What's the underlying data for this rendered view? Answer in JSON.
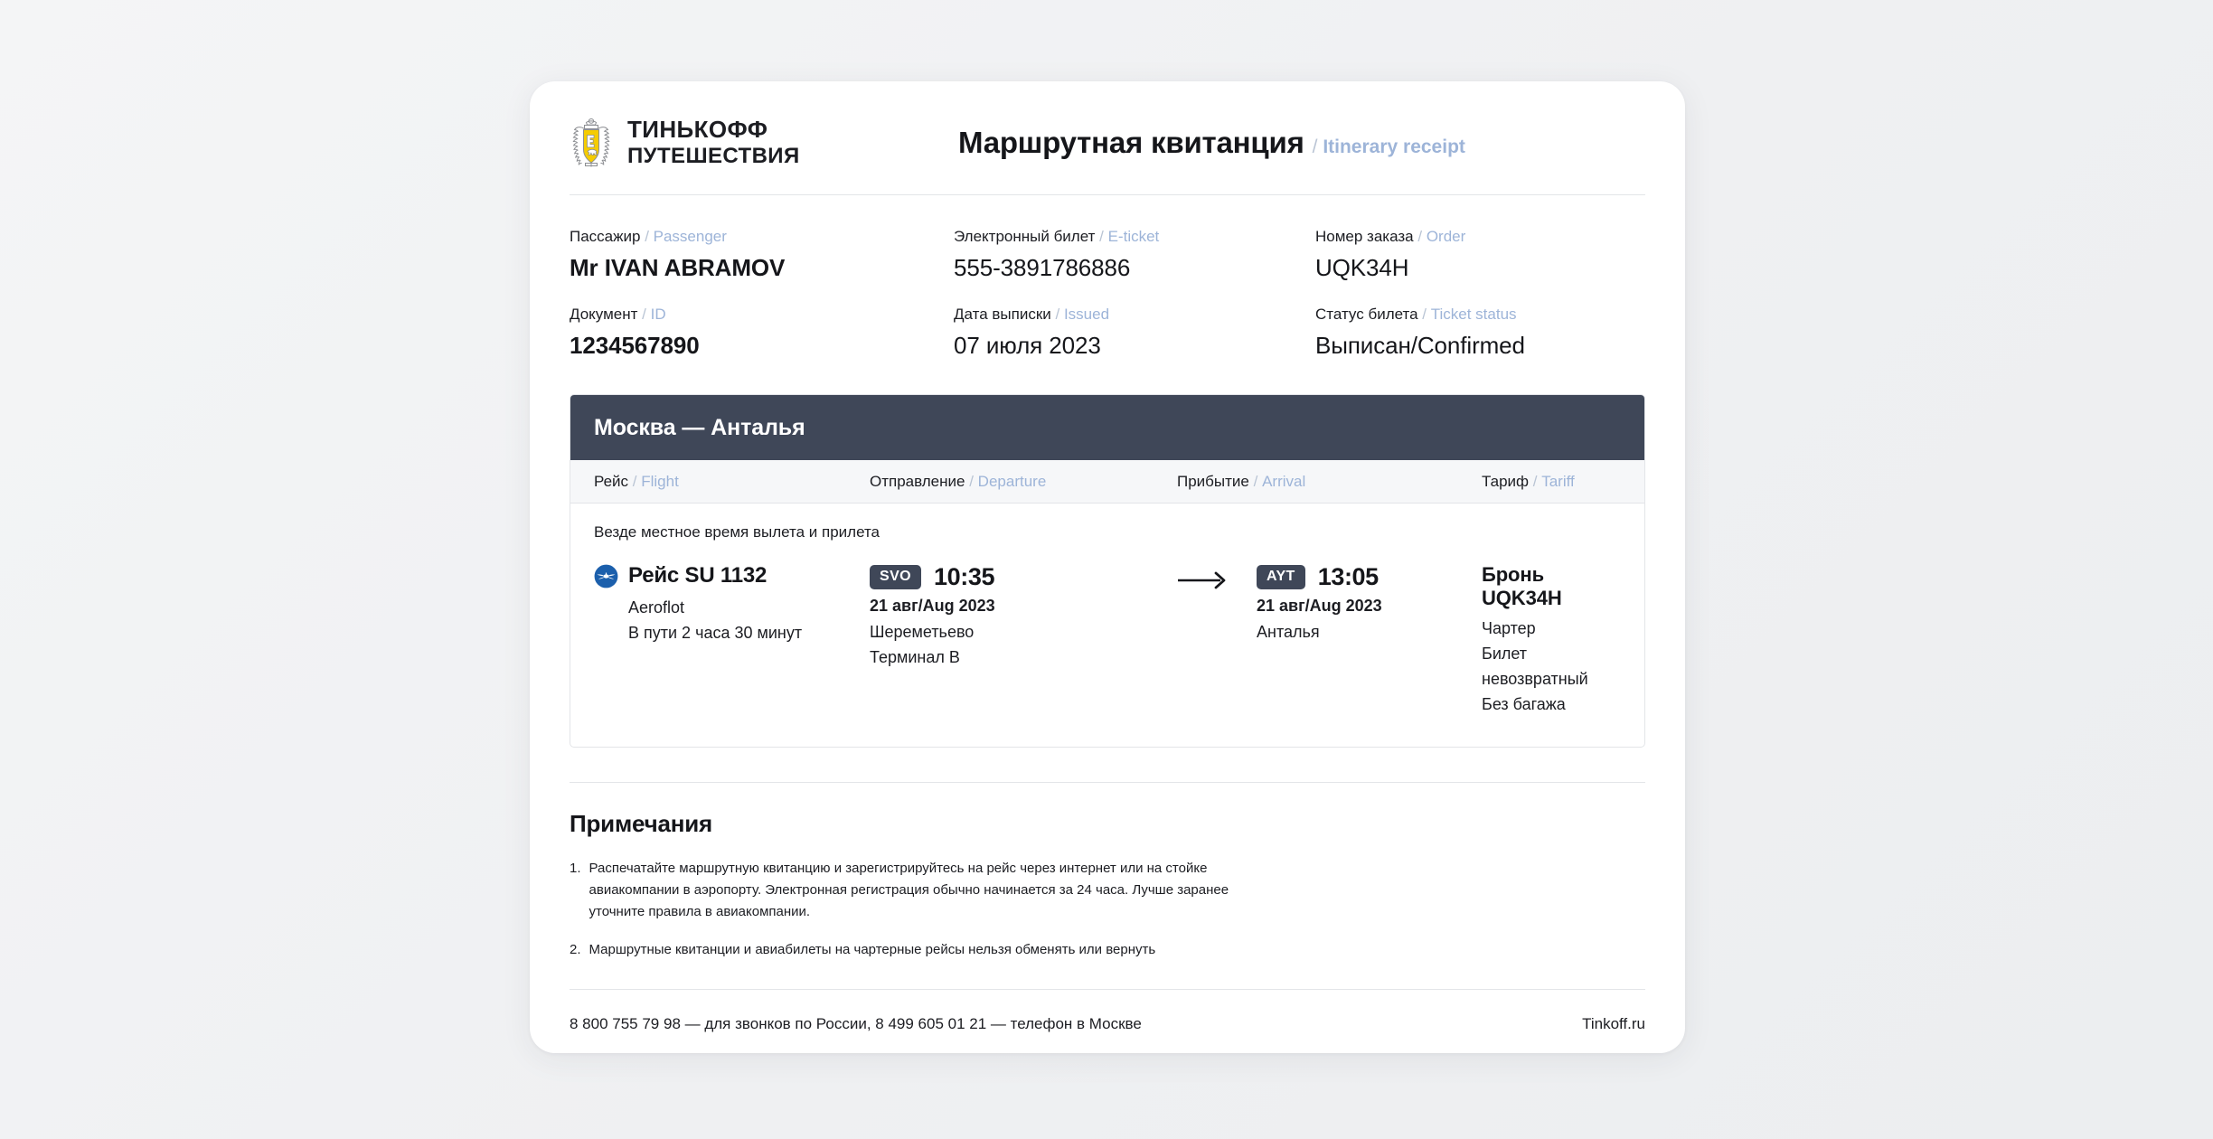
{
  "brand": {
    "emblem_icon": "tinkoff-shield-emblem-icon",
    "line1": "ТИНЬКОФФ",
    "line2": "ПУТЕШЕСТВИЯ",
    "emblem_color": "#F5CC00"
  },
  "header": {
    "title_ru": "Маршрутная квитанция",
    "separator": "/",
    "title_en": "Itinerary receipt"
  },
  "info": {
    "passenger": {
      "label_ru": "Пассажир",
      "label_en": "Passenger",
      "value": "Mr IVAN ABRAMOV"
    },
    "eticket": {
      "label_ru": "Электронный билет",
      "label_en": "E-ticket",
      "value": "555-3891786886"
    },
    "order": {
      "label_ru": "Номер заказа",
      "label_en": "Order",
      "value": "UQK34H"
    },
    "document": {
      "label_ru": "Документ",
      "label_en": "ID",
      "value": "1234567890"
    },
    "issued": {
      "label_ru": "Дата выписки",
      "label_en": "Issued",
      "value": "07 июля 2023"
    },
    "status": {
      "label_ru": "Статус билета",
      "label_en": "Ticket status",
      "value": "Выписан/Confirmed"
    }
  },
  "flight_table": {
    "route_title": "Москва — Анталья",
    "route_bar_color": "#3F4758",
    "columns": {
      "flight": {
        "ru": "Рейс",
        "en": "Flight"
      },
      "departure": {
        "ru": "Отправление",
        "en": "Departure"
      },
      "arrival": {
        "ru": "Прибытие",
        "en": "Arrival"
      },
      "tariff": {
        "ru": "Тариф",
        "en": "Tariff"
      }
    },
    "local_time_note": "Везде местное время вылета и прилета",
    "row": {
      "flight": {
        "airline_icon": "aeroflot-logo-icon",
        "airline_icon_color": "#1B5FAC",
        "number": "Рейс SU 1132",
        "airline": "Aeroflot",
        "duration": "В пути 2 часа 30 минут"
      },
      "departure": {
        "iata": "SVO",
        "time": "10:35",
        "date": "21 авг/Aug 2023",
        "airport": "Шереметьево",
        "terminal": "Терминал B"
      },
      "arrow_icon": "arrow-right-icon",
      "arrival": {
        "iata": "AYT",
        "time": "13:05",
        "date": "21 авг/Aug 2023",
        "airport": "Анталья"
      },
      "tariff": {
        "booking": "Бронь UQK34H",
        "line1": "Чартер",
        "line2": "Билет невозвратный",
        "line3": "Без багажа"
      }
    }
  },
  "notes": {
    "heading": "Примечания",
    "items": [
      {
        "num": "1.",
        "text": "Распечатайте маршрутную квитанцию и зарегистрируйтесь на рейс через интернет или на стойке авиакомпании в аэропорту. Электронная регистрация обычно начинается за 24 часа. Лучше заранее уточните правила в авиакомпании."
      },
      {
        "num": "2.",
        "text": "Маршрутные квитанции и авиабилеты на чартерные рейсы нельзя обменять или вернуть"
      }
    ]
  },
  "footer": {
    "phones": "8 800 755 79 98 — для звонков по России, 8 499 605 01 21 — телефон в Москве",
    "site": "Tinkoff.ru"
  }
}
